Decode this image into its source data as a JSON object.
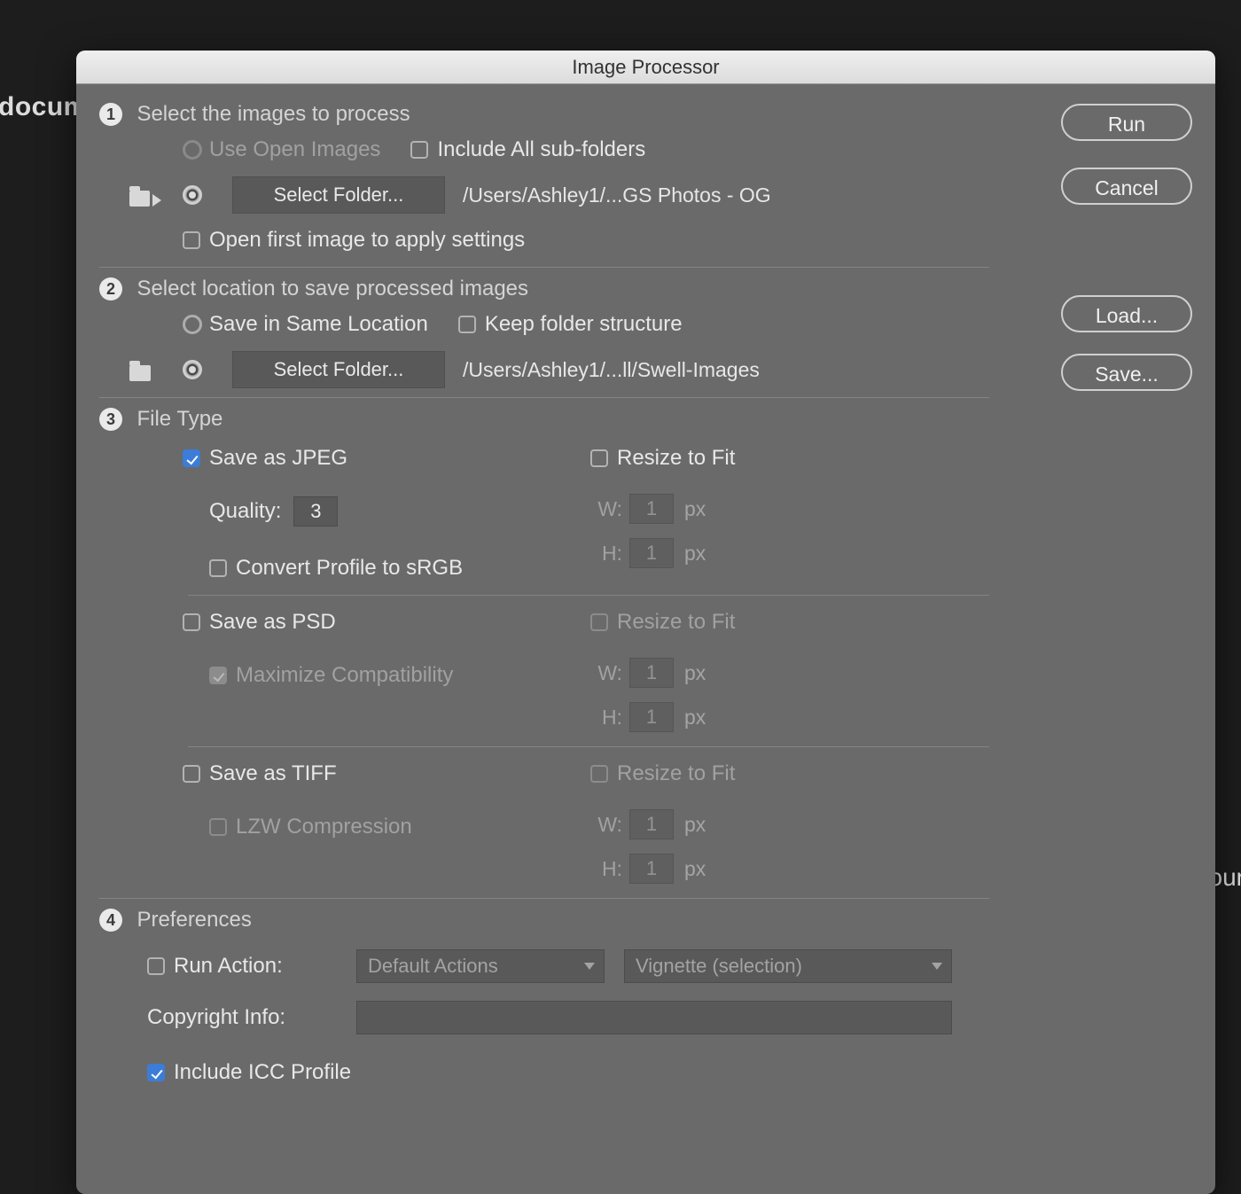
{
  "background": {
    "left_text": "docum",
    "right_text": "your"
  },
  "dialog": {
    "title": "Image Processor",
    "buttons": {
      "run": "Run",
      "cancel": "Cancel",
      "load": "Load...",
      "save": "Save..."
    },
    "section1": {
      "badge": "1",
      "title": "Select the images to process",
      "use_open_images": "Use Open Images",
      "include_subfolders": "Include All sub-folders",
      "select_folder_btn": "Select Folder...",
      "source_path": "/Users/Ashley1/...GS Photos - OG",
      "open_first_image": "Open first image to apply settings"
    },
    "section2": {
      "badge": "2",
      "title": "Select location to save processed images",
      "same_location": "Save in Same Location",
      "keep_structure": "Keep folder structure",
      "select_folder_btn": "Select Folder...",
      "dest_path": "/Users/Ashley1/...ll/Swell-Images"
    },
    "section3": {
      "badge": "3",
      "title": "File Type",
      "jpeg": {
        "label": "Save as JPEG",
        "quality_label": "Quality:",
        "quality_value": "3",
        "srgb": "Convert Profile to sRGB",
        "resize": "Resize to Fit",
        "w": "W:",
        "h": "H:",
        "wval": "1",
        "hval": "1",
        "px": "px"
      },
      "psd": {
        "label": "Save as PSD",
        "maxcompat": "Maximize Compatibility",
        "resize": "Resize to Fit",
        "w": "W:",
        "h": "H:",
        "wval": "1",
        "hval": "1",
        "px": "px"
      },
      "tiff": {
        "label": "Save as TIFF",
        "lzw": "LZW Compression",
        "resize": "Resize to Fit",
        "w": "W:",
        "h": "H:",
        "wval": "1",
        "hval": "1",
        "px": "px"
      }
    },
    "section4": {
      "badge": "4",
      "title": "Preferences",
      "run_action": "Run Action:",
      "action_set": "Default Actions",
      "action_name": "Vignette (selection)",
      "copyright_label": "Copyright Info:",
      "icc": "Include ICC Profile"
    }
  }
}
